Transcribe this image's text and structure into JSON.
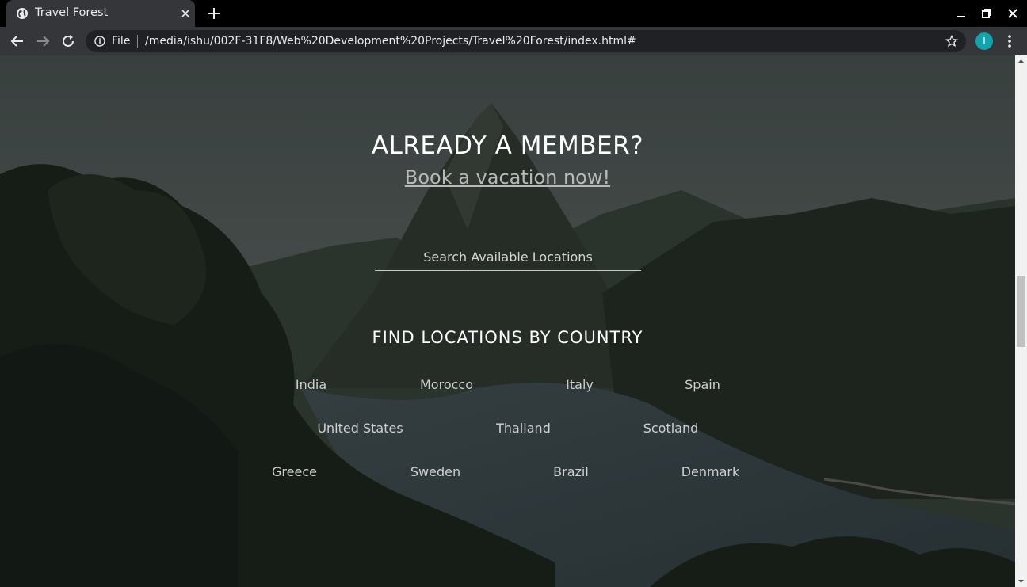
{
  "browser": {
    "tab_title": "Travel Forest",
    "address_scheme": "File",
    "address_url": "/media/ishu/002F-31F8/Web%20Development%20Projects/Travel%20Forest/index.html#",
    "profile_initial": "I",
    "profile_color": "#12a3ad"
  },
  "page": {
    "member_heading": "ALREADY A MEMBER?",
    "book_link": "Book a vacation now!",
    "search_placeholder": "Search Available Locations",
    "country_heading": "FIND LOCATIONS BY COUNTRY",
    "countries": {
      "row1": [
        "India",
        "Morocco",
        "Italy",
        "Spain"
      ],
      "row2": [
        "United States",
        "Thailand",
        "Scotland"
      ],
      "row3": [
        "Greece",
        "Sweden",
        "Brazil",
        "Denmark"
      ]
    }
  },
  "icons": {
    "tab_favicon": "globe-icon",
    "tab_close": "close-icon",
    "new_tab": "plus-icon",
    "back": "back-arrow-icon",
    "forward": "forward-arrow-icon",
    "reload": "reload-icon",
    "site_info": "info-icon",
    "bookmark": "star-icon",
    "menu": "kebab-menu-icon"
  }
}
